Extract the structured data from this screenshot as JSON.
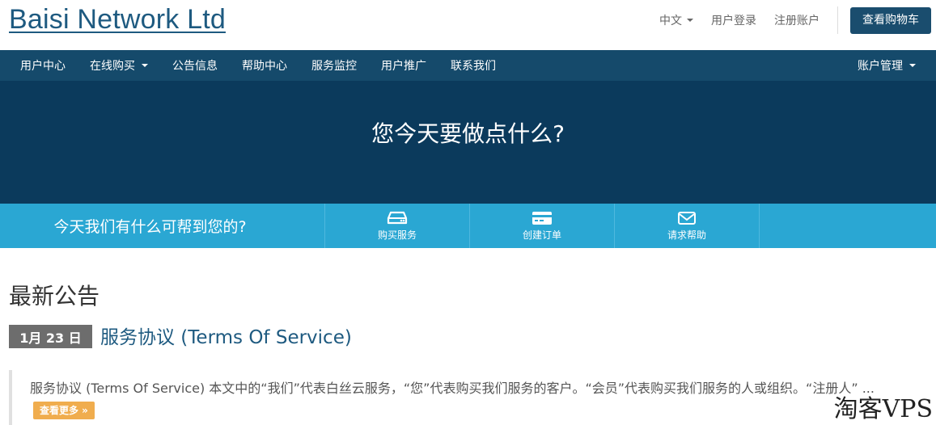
{
  "header": {
    "logo": "Baisi Network Ltd",
    "language": "中文",
    "login": "用户登录",
    "register": "注册账户",
    "cart": "查看购物车"
  },
  "nav": {
    "items": [
      {
        "label": "用户中心",
        "dropdown": false
      },
      {
        "label": "在线购买",
        "dropdown": true
      },
      {
        "label": "公告信息",
        "dropdown": false
      },
      {
        "label": "帮助中心",
        "dropdown": false
      },
      {
        "label": "服务监控",
        "dropdown": false
      },
      {
        "label": "用户推广",
        "dropdown": false
      },
      {
        "label": "联系我们",
        "dropdown": false
      }
    ],
    "account": "账户管理"
  },
  "hero": {
    "title": "您今天要做点什么?"
  },
  "helpbar": {
    "question": "今天我们有什么可帮到您的?",
    "buttons": [
      {
        "label": "购买服务",
        "icon": "server-icon"
      },
      {
        "label": "创建订单",
        "icon": "credit-card-icon"
      },
      {
        "label": "请求帮助",
        "icon": "envelope-icon"
      }
    ]
  },
  "announcements": {
    "section_title": "最新公告",
    "items": [
      {
        "date": "1月 23 日",
        "title": "服务协议 (Terms Of Service)",
        "excerpt": "服务协议 (Terms Of Service) 本文中的“我们”代表白丝云服务，“您”代表购买我们服务的客户。“会员”代表购买我们服务的人或组织。“注册人” ...",
        "more_label": "查看更多 »"
      }
    ]
  },
  "watermark": "淘客VPS",
  "colors": {
    "brand": "#1e5a80",
    "navbar": "#154a6b",
    "hero": "#0b3a5c",
    "helpbar": "#2aa7d3",
    "more_button": "#f0ad4e"
  }
}
